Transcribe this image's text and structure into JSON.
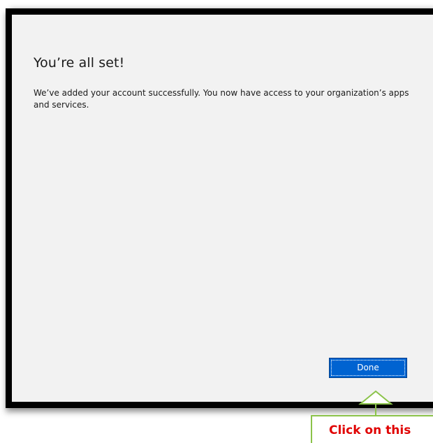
{
  "dialog": {
    "title": "You’re all set!",
    "message": "We’ve added your account successfully. You now have access to your organization’s apps and services.",
    "done_label": "Done"
  },
  "annotation": {
    "callout_text": "Click on this",
    "callout_color": "#e00000",
    "outline_color": "#8bc34a"
  },
  "colors": {
    "accent": "#0063d1",
    "dialog_background": "#f2f2f2",
    "frame": "#000000"
  }
}
